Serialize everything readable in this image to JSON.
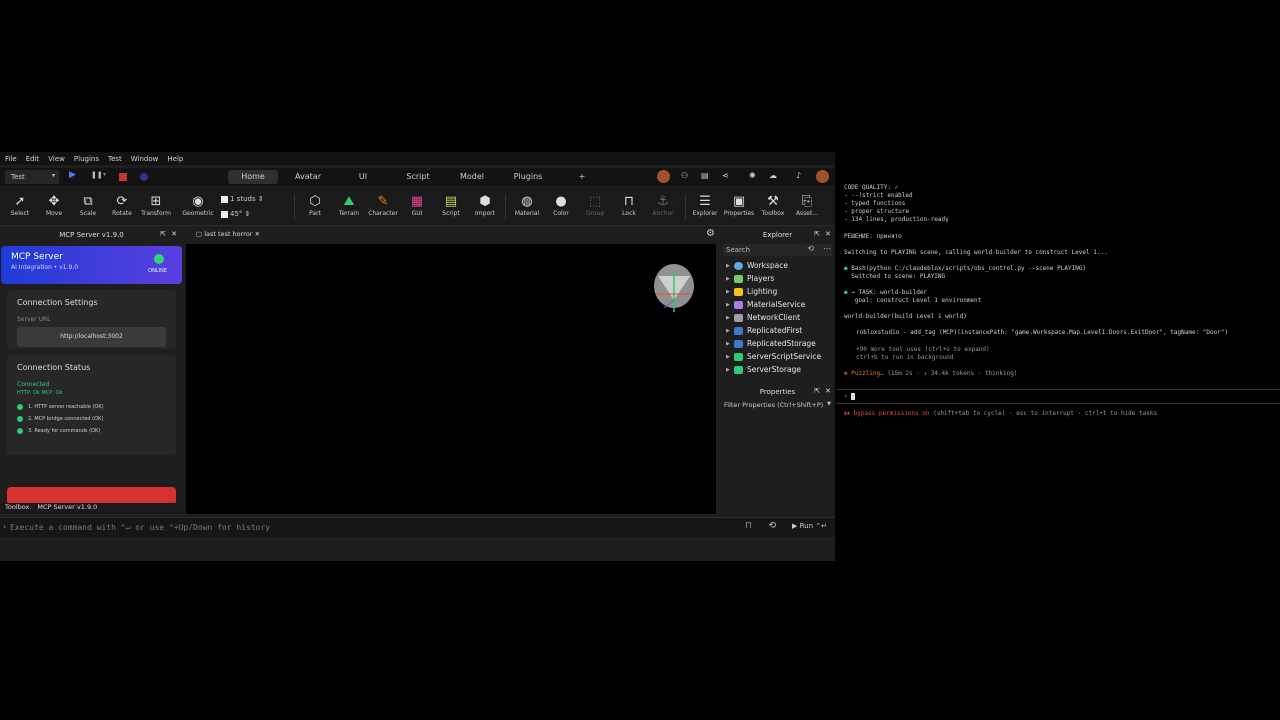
{
  "menu": [
    "File",
    "Edit",
    "View",
    "Plugins",
    "Test",
    "Window",
    "Help"
  ],
  "mode_select": "Test",
  "ribbon_tabs": [
    "Home",
    "Avatar",
    "UI",
    "Script",
    "Model",
    "Plugins",
    "+"
  ],
  "ribbon_tools": {
    "select": "Select",
    "move": "Move",
    "scale": "Scale",
    "rotate": "Rotate",
    "transform": "Transform",
    "geometric": "Geometric",
    "studs": "1 studs",
    "angle": "45°",
    "part": "Part",
    "terrain": "Terrain",
    "character": "Character",
    "gui": "GUI",
    "script": "Script",
    "import": "Import",
    "material": "Material",
    "color": "Color",
    "group": "Group",
    "lock": "Lock",
    "anchor": "Anchor",
    "explorer": "Explorer",
    "properties": "Properties",
    "toolbox": "Toolbox",
    "assets": "Asset..."
  },
  "mcp_panel": {
    "title": "MCP Server v1.9.0",
    "banner_title": "MCP Server",
    "banner_sub": "AI Integration • v1.9.0",
    "online": "ONLINE",
    "conn_settings": "Connection Settings",
    "server_url_label": "Server URL",
    "server_url": "http://localhost:3002",
    "conn_status": "Connection Status",
    "connected": "Connected",
    "http_mcp": "HTTP: Ok  MCP: Ok",
    "checks": [
      "1. HTTP server reachable (OK)",
      "2. MCP bridge connected (OK)",
      "3. Ready for commands (OK)"
    ]
  },
  "bottom_tabs": [
    "Toolbox",
    "MCP Server v1.9.0"
  ],
  "viewport_tab": "last test horror",
  "explorer": {
    "title": "Explorer",
    "search": "Search",
    "items": [
      {
        "label": "Workspace",
        "color": "#5fa8e8"
      },
      {
        "label": "Players",
        "color": "#7bc66f"
      },
      {
        "label": "Lighting",
        "color": "#f1c40f"
      },
      {
        "label": "MaterialService",
        "color": "#b07be0"
      },
      {
        "label": "NetworkClient",
        "color": "#9aa0a6"
      },
      {
        "label": "ReplicatedFirst",
        "color": "#3b78c9"
      },
      {
        "label": "ReplicatedStorage",
        "color": "#3b78c9"
      },
      {
        "label": "ServerScriptService",
        "color": "#2ecc71"
      },
      {
        "label": "ServerStorage",
        "color": "#2ecc71"
      }
    ]
  },
  "properties": {
    "title": "Properties",
    "filter": "Filter Properties (Ctrl+Shift+P)"
  },
  "command": {
    "placeholder": "Execute a command with ⌃↵ or use ⌃+Up/Down for history",
    "run": "Run ⌃↵"
  },
  "terminal": {
    "lines": [
      "CODE QUALITY: ✓",
      "- --!strict enabled",
      "- typed functions",
      "- proper structure",
      "- 134 lines, production-ready",
      "РЕШЕНИЕ: принято",
      "Switching to PLAYING scene, calling world-builder to construct Level 1...",
      "Bash(python C:/claudeblox/scripts/obs_control.py --scene PLAYING)",
      "  Switched to scene: PLAYING",
      "→ TASK: world-builder",
      "   goal: construct Level 1 environment",
      "world-builder(build Level 1 world)",
      "robloxstudio - add_tag (MCP)(instancePath: \"game.Workspace.Map.Level1.Doors.ExitDoor\", tagName: \"Door\")",
      "+90 more tool uses (ctrl+o to expand)",
      "ctrl+b to run in background",
      "Puzzling…",
      "(15m 2s · ↓ 34.4k tokens · thinking)",
      "bypass permissions on",
      "(shift+tab to cycle) · esc to interrupt · ctrl+t to hide tasks"
    ]
  }
}
